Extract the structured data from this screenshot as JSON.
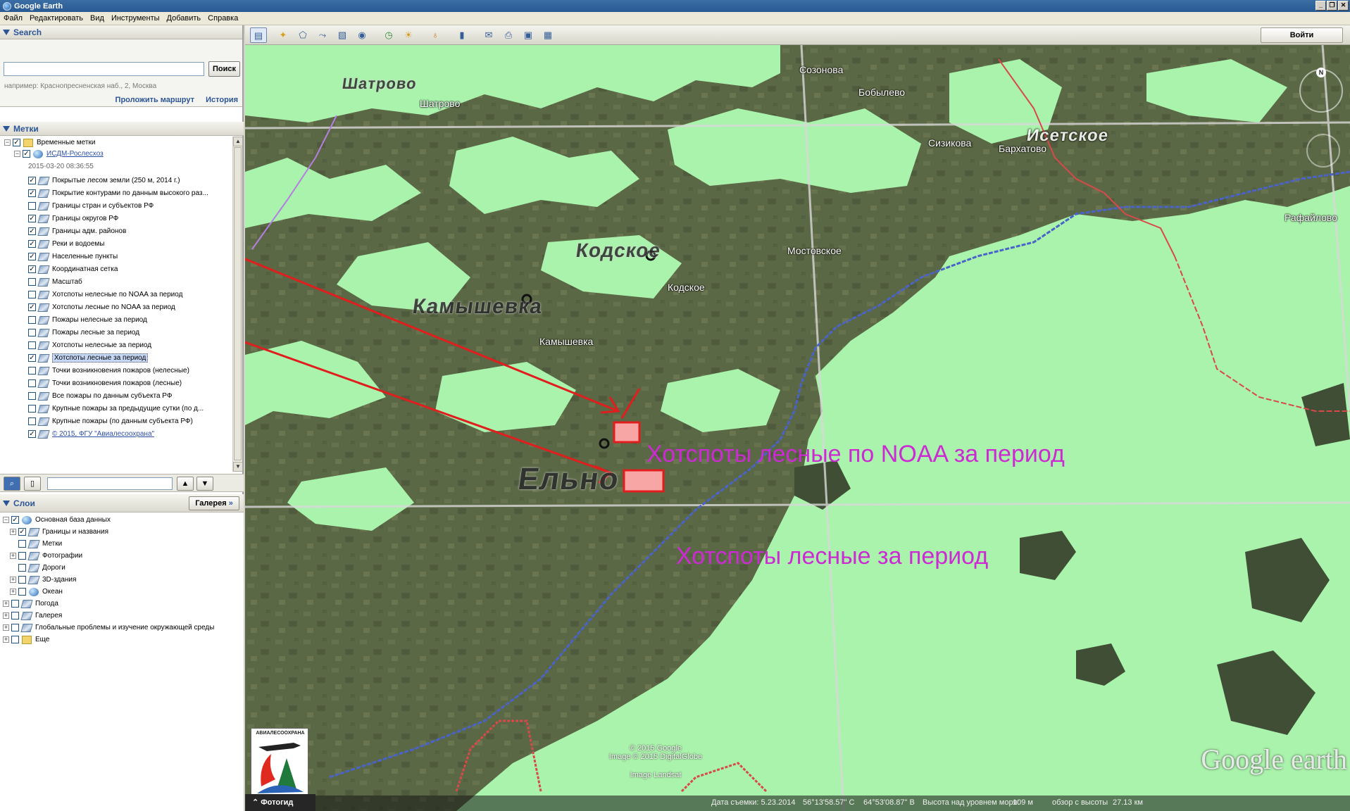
{
  "window": {
    "title": "Google Earth"
  },
  "menu": [
    "Файл",
    "Редактировать",
    "Вид",
    "Инструменты",
    "Добавить",
    "Справка"
  ],
  "search": {
    "header": "Search",
    "button": "Поиск",
    "hint": "например: Краснопресненская наб., 2, Москва",
    "route_link": "Проложить маршрут",
    "history_link": "История"
  },
  "places": {
    "header": "Метки",
    "items": [
      {
        "label": "Временные метки",
        "checked": true,
        "level": 0,
        "icon": "folder-icon"
      },
      {
        "label": "ИСДМ-Рослесхоз",
        "checked": true,
        "level": 1,
        "icon": "globe-icon",
        "link": true
      },
      {
        "label": "2015-03-20 08:36:55",
        "checked": null,
        "level": 2,
        "date": true
      },
      {
        "label": "Покрытые лесом земли (250 м, 2014 г.)",
        "checked": true,
        "level": 2
      },
      {
        "label": "Покрытие контурами по данным высокого раз...",
        "checked": true,
        "level": 2
      },
      {
        "label": "Границы стран и субъектов РФ",
        "checked": false,
        "level": 2
      },
      {
        "label": "Границы округов РФ",
        "checked": true,
        "level": 2
      },
      {
        "label": "Границы адм. районов",
        "checked": true,
        "level": 2
      },
      {
        "label": "Реки и водоемы",
        "checked": true,
        "level": 2
      },
      {
        "label": "Населенные пункты",
        "checked": true,
        "level": 2
      },
      {
        "label": "Координатная сетка",
        "checked": true,
        "level": 2
      },
      {
        "label": "Масштаб",
        "checked": false,
        "level": 2
      },
      {
        "label": "Хотспоты нелесные по NOAA за период",
        "checked": false,
        "level": 2
      },
      {
        "label": "Хотспоты лесные по NOAA за период",
        "checked": true,
        "level": 2
      },
      {
        "label": "Пожары нелесные за период",
        "checked": false,
        "level": 2
      },
      {
        "label": "Пожары лесные за период",
        "checked": false,
        "level": 2
      },
      {
        "label": "Хотспоты нелесные за период",
        "checked": false,
        "level": 2
      },
      {
        "label": "Хотспоты лесные за период",
        "checked": true,
        "level": 2,
        "selected": true
      },
      {
        "label": "Точки возникновения пожаров (нелесные)",
        "checked": false,
        "level": 2
      },
      {
        "label": "Точки возникновения пожаров (лесные)",
        "checked": false,
        "level": 2
      },
      {
        "label": "Все пожары по данным субъекта РФ",
        "checked": false,
        "level": 2
      },
      {
        "label": "Крупные пожары за предыдущие сутки (по д...",
        "checked": false,
        "level": 2
      },
      {
        "label": "Крупные пожары (по данным субъекта РФ)",
        "checked": false,
        "level": 2
      },
      {
        "label": "© 2015, ФГУ \"Авиалесоохрана\"",
        "checked": true,
        "level": 2,
        "link": true
      }
    ]
  },
  "layers": {
    "header": "Слои",
    "gallery_button": "Галерея",
    "items": [
      {
        "label": "Основная база данных",
        "checked": true,
        "level": 0,
        "exp": "-"
      },
      {
        "label": "Границы и названия",
        "checked": true,
        "level": 1,
        "exp": "+"
      },
      {
        "label": "Метки",
        "checked": false,
        "level": 1,
        "exp": ""
      },
      {
        "label": "Фотографии",
        "checked": false,
        "level": 1,
        "exp": "+"
      },
      {
        "label": "Дороги",
        "checked": false,
        "level": 1,
        "exp": ""
      },
      {
        "label": "3D-здания",
        "checked": false,
        "level": 1,
        "exp": "+"
      },
      {
        "label": "Океан",
        "checked": false,
        "level": 1,
        "exp": "+"
      },
      {
        "label": "Погода",
        "checked": false,
        "level": 0,
        "exp": "+"
      },
      {
        "label": "Галерея",
        "checked": false,
        "level": 0,
        "exp": "+"
      },
      {
        "label": "Глобальные проблемы и изучение окружающей среды",
        "checked": false,
        "level": 0,
        "exp": "+"
      },
      {
        "label": "Еще",
        "checked": false,
        "level": 0,
        "exp": "+"
      }
    ]
  },
  "toolbar": {
    "login": "Войти"
  },
  "map": {
    "towns": [
      "Созонова",
      "Бобылево",
      "Шатрово",
      "Сизикова",
      "Бархатово",
      "Рафайлово",
      "Мостовское",
      "Кодское",
      "Камышевка"
    ],
    "big_labels": [
      "Шатрово",
      "Кодское",
      "Камышевка",
      "Ельно",
      "Исетское"
    ],
    "annotations": [
      "Хотспоты лесные по NOAA за период",
      "Хотспоты лесные за период"
    ],
    "copyright": [
      "© 2015 Google",
      "Image © 2015 DigitalGlobe",
      "Image Landsat"
    ],
    "tour_button": "Фотогид",
    "status": {
      "date": "Дата съемки: 5.23.2014",
      "lat": "56°13'58.57\" С",
      "lon": "64°53'08.87\" В",
      "elev": "Высота над уровнем моря:",
      "elev_val": "109 м",
      "eye": "обзор с высоты",
      "eye_val": "27.13 км"
    },
    "watermark": "Google earth",
    "logo_text": "АВИАЛЕСООХРАНА",
    "compass_n": "N"
  }
}
